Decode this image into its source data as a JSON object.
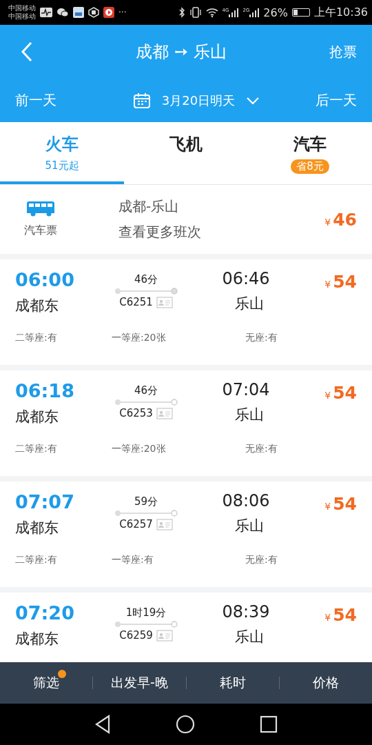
{
  "status_bar": {
    "carriers": [
      "中国移动",
      "中国移动"
    ],
    "more": "···",
    "net_1": "4G",
    "net_2": "2G",
    "battery": "26%",
    "time": "上午10:36"
  },
  "header": {
    "title": "成都 ➙ 乐山",
    "action": "抢票"
  },
  "date_bar": {
    "prev": "前一天",
    "date": "3月20日明天",
    "next": "后一天"
  },
  "tabs": [
    {
      "label": "火车",
      "sub": "51元起",
      "selected": true
    },
    {
      "label": "飞机",
      "selected": false
    },
    {
      "label": "汽车",
      "badge": "省8元",
      "selected": false
    }
  ],
  "bus_promo": {
    "label": "汽车票",
    "route": "成都-乐山",
    "more": "查看更多班次",
    "currency": "¥",
    "price": "46"
  },
  "trains": [
    {
      "depart": "06:00",
      "from": "成都东",
      "duration": "46分",
      "number": "C6251",
      "arrive": "06:46",
      "to": "乐山",
      "currency": "¥",
      "price": "54",
      "terminal_filled": true,
      "seats": [
        "二等座:有",
        "一等座:20张",
        "无座:有"
      ]
    },
    {
      "depart": "06:18",
      "from": "成都东",
      "duration": "46分",
      "number": "C6253",
      "arrive": "07:04",
      "to": "乐山",
      "currency": "¥",
      "price": "54",
      "terminal_filled": false,
      "seats": [
        "二等座:有",
        "一等座:20张",
        "无座:有"
      ]
    },
    {
      "depart": "07:07",
      "from": "成都东",
      "duration": "59分",
      "number": "C6257",
      "arrive": "08:06",
      "to": "乐山",
      "currency": "¥",
      "price": "54",
      "terminal_filled": false,
      "seats": [
        "二等座:有",
        "一等座:有",
        "无座:有"
      ]
    },
    {
      "depart": "07:20",
      "from": "成都东",
      "duration": "1时19分",
      "number": "C6259",
      "arrive": "08:39",
      "to": "乐山",
      "currency": "¥",
      "price": "54",
      "terminal_filled": false
    }
  ],
  "bottom_bar": [
    {
      "label": "筛选",
      "dot": true
    },
    {
      "label": "出发早-晚",
      "dot": false
    },
    {
      "label": "耗时",
      "dot": false
    },
    {
      "label": "价格",
      "dot": false
    }
  ]
}
